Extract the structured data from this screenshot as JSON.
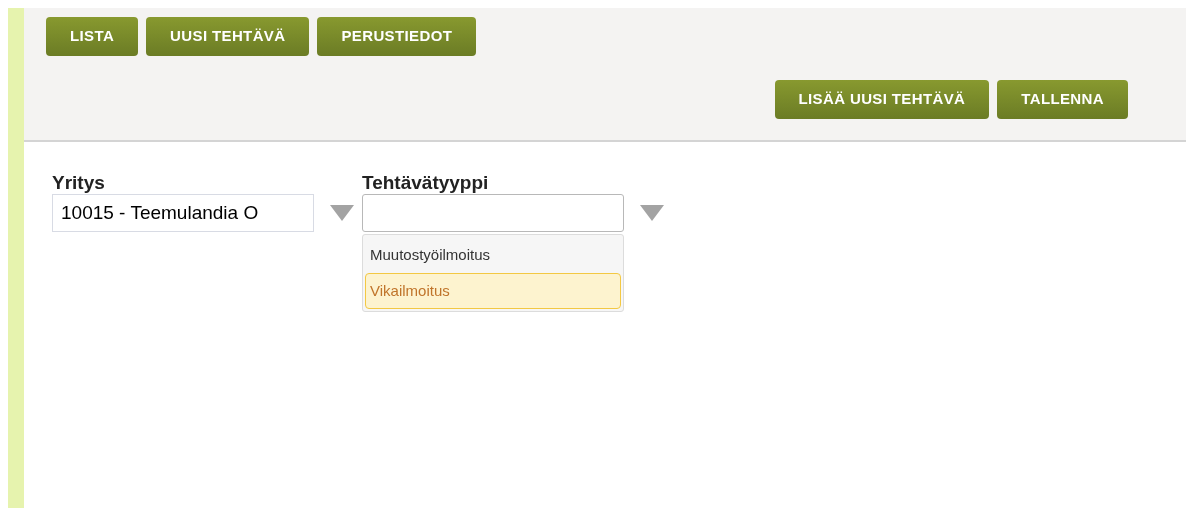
{
  "nav_buttons": [
    "LISTA",
    "UUSI TEHTÄVÄ",
    "PERUSTIEDOT"
  ],
  "action_buttons": [
    "LISÄÄ UUSI TEHTÄVÄ",
    "TALLENNA"
  ],
  "fields": [
    {
      "label": "Yritys",
      "value": "10015 - Teemulandia O",
      "expanded": false
    },
    {
      "label": "Tehtävätyyppi",
      "expanded": true,
      "options": [
        {
          "label": "Muutostyöilmoitus",
          "selected": false
        },
        {
          "label": "Vikailmoitus",
          "selected": true
        }
      ]
    }
  ]
}
